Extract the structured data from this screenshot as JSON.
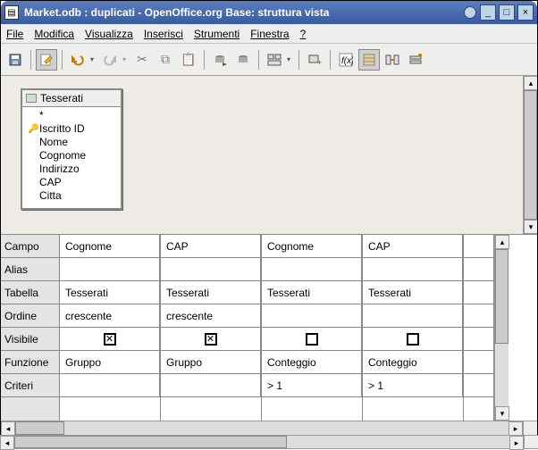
{
  "window": {
    "title": "Market.odb : duplicati - OpenOffice.org Base: struttura vista",
    "minimize": "_",
    "maximize": "□",
    "close": "×"
  },
  "menu": {
    "file": "File",
    "modifica": "Modifica",
    "visualizza": "Visualizza",
    "inserisci": "Inserisci",
    "strumenti": "Strumenti",
    "finestra": "Finestra",
    "help": "?"
  },
  "table_panel": {
    "title": "Tesserati",
    "fields": [
      "*",
      "Iscritto ID",
      "Nome",
      "Cognome",
      "Indirizzo",
      "CAP",
      "Citta"
    ],
    "key_index": 1
  },
  "grid": {
    "row_headers": [
      "Campo",
      "Alias",
      "Tabella",
      "Ordine",
      "Visibile",
      "Funzione",
      "Criteri"
    ],
    "columns": [
      {
        "campo": "Cognome",
        "alias": "",
        "tabella": "Tesserati",
        "ordine": "crescente",
        "visibile": true,
        "funzione": "Gruppo",
        "criteri": ""
      },
      {
        "campo": "CAP",
        "alias": "",
        "tabella": "Tesserati",
        "ordine": "crescente",
        "visibile": true,
        "funzione": "Gruppo",
        "criteri": ""
      },
      {
        "campo": "Cognome",
        "alias": "",
        "tabella": "Tesserati",
        "ordine": "",
        "visibile": false,
        "funzione": "Conteggio",
        "criteri": "> 1"
      },
      {
        "campo": "CAP",
        "alias": "",
        "tabella": "Tesserati",
        "ordine": "",
        "visibile": false,
        "funzione": "Conteggio",
        "criteri": "> 1"
      }
    ]
  },
  "checkbox_glyph": "✕"
}
